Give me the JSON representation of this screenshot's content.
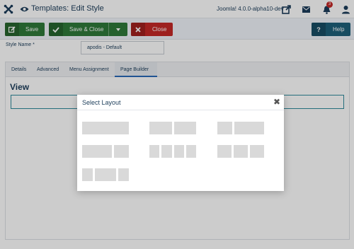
{
  "header": {
    "title": "Templates: Edit Style",
    "version": "Joomla! 4.0.0-alpha10-dev",
    "notification_count": "3",
    "icons": [
      "joomla-logo-icon",
      "eye-icon",
      "external-link-icon",
      "envelope-icon",
      "bell-icon",
      "user-icon"
    ]
  },
  "toolbar": {
    "save_label": "Save",
    "save_close_label": "Save & Close",
    "close_label": "Close",
    "help_label": "Help"
  },
  "form": {
    "style_name_label": "Style Name *",
    "style_name_value": "apodis - Default"
  },
  "tabs": [
    "Details",
    "Advanced",
    "Menu Assignment",
    "Page Builder"
  ],
  "active_tab": "Page Builder",
  "builder": {
    "heading": "View"
  },
  "modal": {
    "title": "Select Layout",
    "close_glyph": "✖",
    "layouts": [
      {
        "name": "layout-12",
        "columns": [
          12
        ]
      },
      {
        "name": "layout-6-6",
        "columns": [
          6,
          6
        ]
      },
      {
        "name": "layout-4-8",
        "columns": [
          4,
          8
        ]
      },
      {
        "name": "layout-8-4",
        "columns": [
          8,
          4
        ]
      },
      {
        "name": "layout-3-3-3-3",
        "columns": [
          3,
          3,
          3,
          3
        ]
      },
      {
        "name": "layout-4-4-4",
        "columns": [
          4,
          4,
          4
        ]
      },
      {
        "name": "layout-3-6-3",
        "columns": [
          3,
          6,
          3
        ]
      }
    ]
  },
  "colors": {
    "save": "#2f7a3a",
    "close": "#c52827",
    "help": "#1d5f7a",
    "active_tab": "#2a69b8",
    "layout_block": "#d9d9d9"
  }
}
